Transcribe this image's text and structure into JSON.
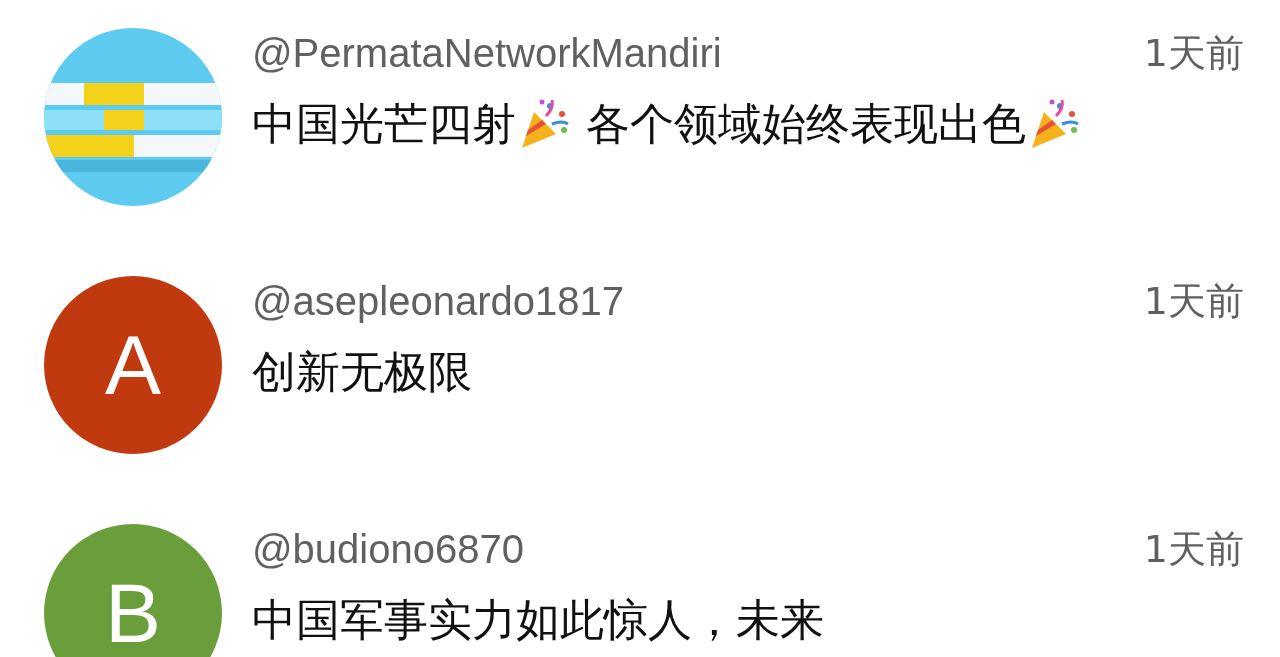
{
  "comments": [
    {
      "username": "@PermataNetworkMandiri",
      "time": "1天前",
      "parts": [
        {
          "kind": "text",
          "text": "中国光芒四射"
        },
        {
          "kind": "emoji"
        },
        {
          "kind": "text",
          "text": " 各个领域始终表现出色"
        },
        {
          "kind": "emoji"
        }
      ]
    },
    {
      "avatar": {
        "kind": "letter",
        "letter": "A",
        "color": "#c0390f"
      },
      "username": "@asepleonardo1817",
      "time": "1天前",
      "parts": [
        {
          "kind": "text",
          "text": "创新无极限"
        }
      ]
    },
    {
      "avatar": {
        "kind": "letter",
        "letter": "B",
        "color": "#6a9e3b"
      },
      "username": "@budiono6870",
      "time": "1天前",
      "parts": [
        {
          "kind": "text",
          "text": "中国军事实力如此惊人，未来"
        }
      ]
    }
  ]
}
